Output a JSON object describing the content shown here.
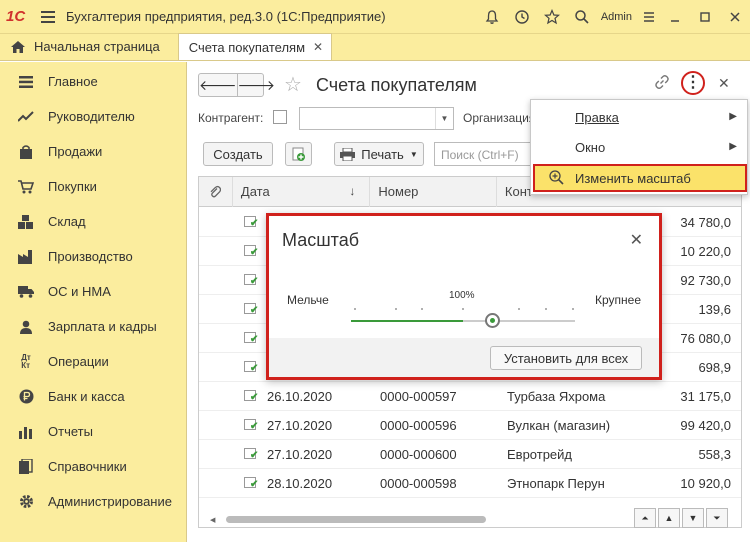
{
  "window": {
    "app_title": "Бухгалтерия предприятия, ред.3.0  (1С:Предприятие)",
    "user": "Admin",
    "logo_text": "1С"
  },
  "tabs": {
    "home": "Начальная страница",
    "active": "Счета покупателям"
  },
  "sidebar": {
    "items": [
      {
        "label": "Главное",
        "icon": "menu-icon"
      },
      {
        "label": "Руководителю",
        "icon": "chart-line-icon"
      },
      {
        "label": "Продажи",
        "icon": "shopping-bag-icon"
      },
      {
        "label": "Покупки",
        "icon": "cart-icon"
      },
      {
        "label": "Склад",
        "icon": "boxes-icon"
      },
      {
        "label": "Производство",
        "icon": "factory-icon"
      },
      {
        "label": "ОС и НМА",
        "icon": "truck-icon"
      },
      {
        "label": "Зарплата и кадры",
        "icon": "person-icon"
      },
      {
        "label": "Операции",
        "icon": "debit-credit-icon"
      },
      {
        "label": "Банк и касса",
        "icon": "ruble-coin-icon"
      },
      {
        "label": "Отчеты",
        "icon": "bar-chart-icon"
      },
      {
        "label": "Справочники",
        "icon": "books-icon"
      },
      {
        "label": "Администрирование",
        "icon": "gear-icon"
      }
    ]
  },
  "form": {
    "title": "Счета покупателям",
    "filter_label": "Контрагент:",
    "org_label": "Организация",
    "create_label": "Создать",
    "print_label": "Печать",
    "search_placeholder": "Поиск (Ctrl+F)"
  },
  "table": {
    "columns": [
      "Дата",
      "Номер",
      "Конт"
    ],
    "rows": [
      {
        "date": "",
        "number": "",
        "counterparty": "",
        "amount": "34 780,0"
      },
      {
        "date": "",
        "number": "",
        "counterparty": "",
        "amount": "10 220,0"
      },
      {
        "date": "",
        "number": "",
        "counterparty": "",
        "amount": "92 730,0"
      },
      {
        "date": "",
        "number": "",
        "counterparty": "",
        "amount": "139,6"
      },
      {
        "date": "",
        "number": "",
        "counterparty": "",
        "amount": "76 080,0"
      },
      {
        "date": "",
        "number": "",
        "counterparty": "",
        "amount": "698,9"
      },
      {
        "date": "26.10.2020",
        "number": "0000-000597",
        "counterparty": "Турбаза Яхрома",
        "amount": "31 175,0"
      },
      {
        "date": "27.10.2020",
        "number": "0000-000596",
        "counterparty": "Вулкан (магазин)",
        "amount": "99 420,0"
      },
      {
        "date": "27.10.2020",
        "number": "0000-000600",
        "counterparty": "Евротрейд",
        "amount": "558,3"
      },
      {
        "date": "28.10.2020",
        "number": "0000-000598",
        "counterparty": "Этнопарк Перун",
        "amount": "10 920,0"
      }
    ]
  },
  "menu": {
    "items": [
      {
        "label": "Правка"
      },
      {
        "label": "Окно"
      },
      {
        "label": "Изменить масштаб"
      }
    ]
  },
  "zoom_dialog": {
    "title": "Масштаб",
    "smaller": "Мельче",
    "larger": "Крупнее",
    "percent": "100%",
    "level_fraction": 0.5,
    "apply_all": "Установить для всех"
  },
  "colors": {
    "panel": "#fbed9e",
    "highlight": "#fbe26a",
    "callout_red": "#d0211c",
    "accent_green": "#3a9a3a"
  }
}
